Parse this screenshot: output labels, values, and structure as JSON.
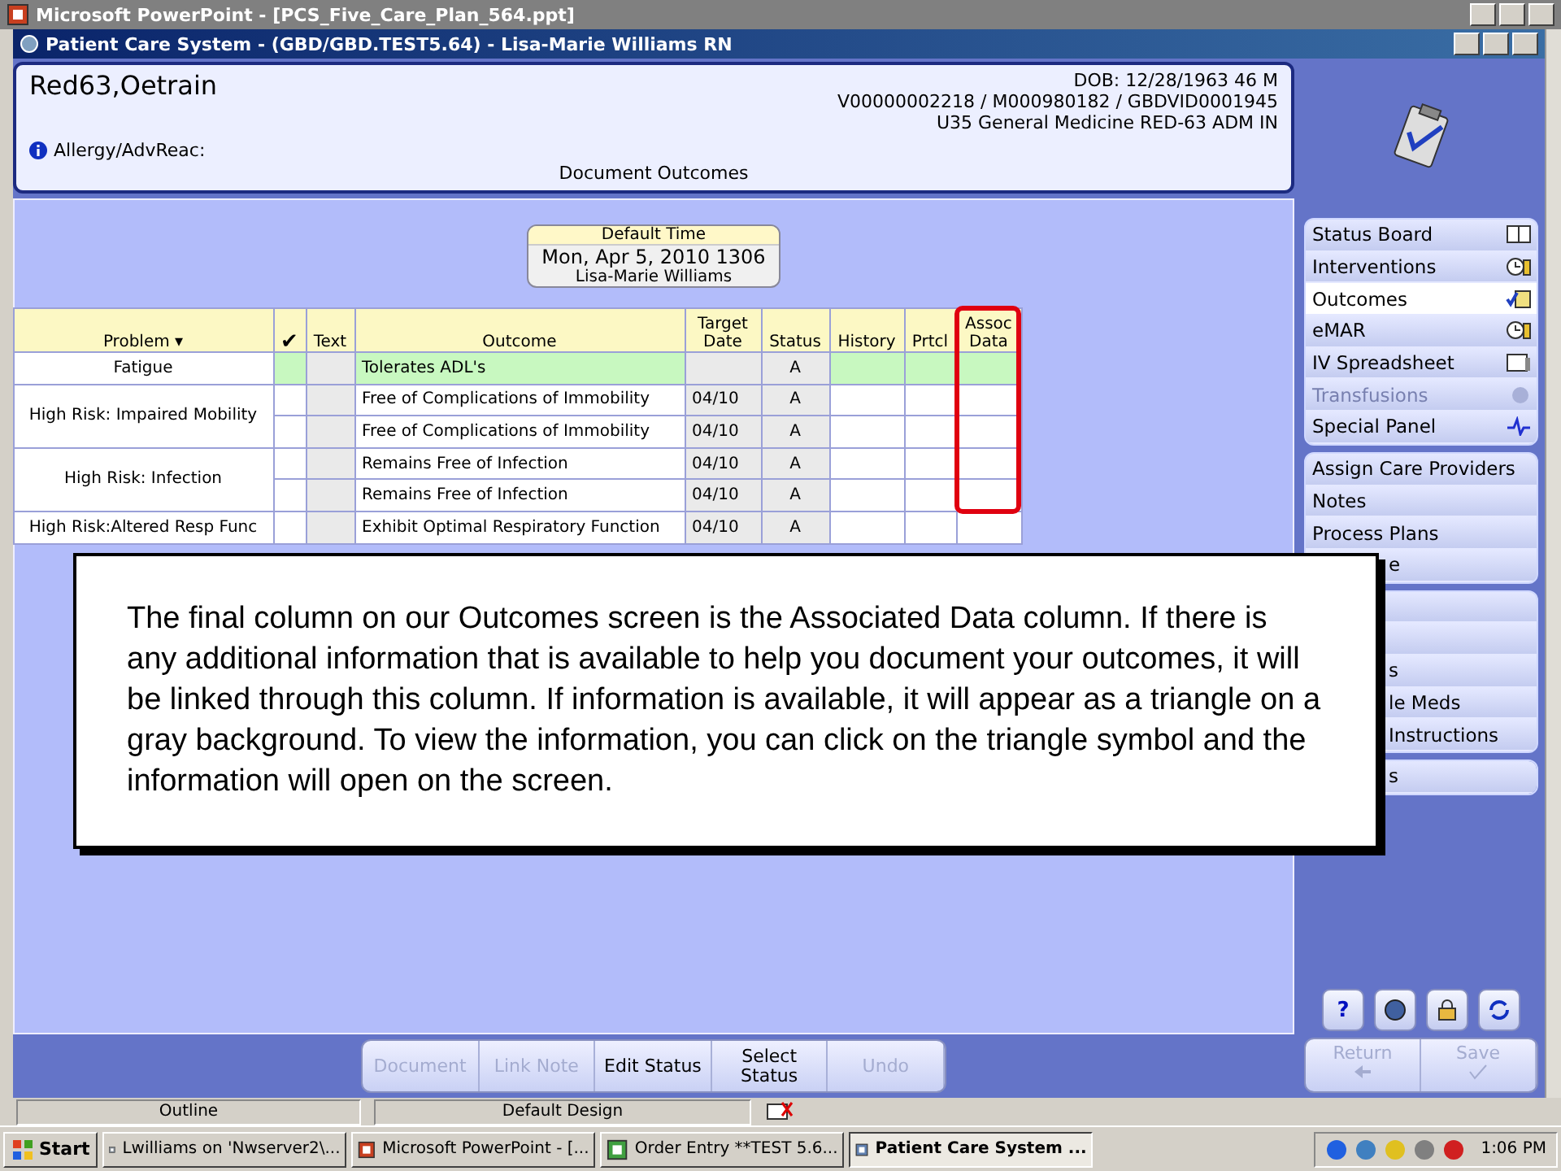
{
  "ppt_window": {
    "title": "Microsoft PowerPoint - [PCS_Five_Care_Plan_564.ppt]"
  },
  "app_window": {
    "title": "Patient Care System - (GBD/GBD.TEST5.64) - Lisa-Marie Williams RN"
  },
  "patient": {
    "name": "Red63,Oetrain",
    "dob": "DOB: 12/28/1963 46 M",
    "ids": "V00000002218 / M000980182 / GBDVID0001945",
    "location": "U35 General Medicine  RED-63  ADM IN",
    "allergy": "Allergy/AdvReac:",
    "screen_title": "Document Outcomes"
  },
  "default_time": {
    "label": "Default Time",
    "date": "Mon, Apr 5, 2010  1306",
    "user": "Lisa-Marie Williams"
  },
  "table": {
    "columns": [
      "Problem ▾",
      "✔",
      "Text",
      "Outcome",
      "Target Date",
      "Status",
      "History",
      "Prtcl",
      "Assoc Data"
    ],
    "groups": [
      {
        "problem": "Fatigue",
        "selected": true,
        "outcomes": [
          {
            "outcome": "Tolerates ADL's",
            "status": "A"
          }
        ]
      },
      {
        "problem": "High Risk: Impaired Mobility",
        "selected": false,
        "outcomes": [
          {
            "outcome": "Free of Complications of Immobility",
            "target": "04/10",
            "status": "A"
          },
          {
            "outcome": "Free of Complications of Immobility",
            "target": "04/10",
            "status": "A"
          }
        ]
      },
      {
        "problem": "High Risk: Infection",
        "selected": false,
        "outcomes": [
          {
            "outcome": "Remains Free of Infection",
            "target": "04/10",
            "status": "A"
          },
          {
            "outcome": "Remains Free of Infection",
            "target": "04/10",
            "status": "A"
          }
        ]
      },
      {
        "problem": "High Risk:Altered Resp Func",
        "selected": false,
        "outcomes": [
          {
            "outcome": "Exhibit Optimal Respiratory Function",
            "target": "04/10",
            "status": "A"
          }
        ]
      }
    ]
  },
  "callout": {
    "text": "The final column on our Outcomes screen is the Associated Data column. If there is any additional information that is available to help you document your outcomes, it will be linked through this column. If information is available, it will appear as a triangle on a gray background. To view the information, you can click on the triangle symbol and the information will open on the screen."
  },
  "sidebar": [
    [
      {
        "label": "Status Board",
        "selected": false,
        "disabled": false
      },
      {
        "label": "Interventions",
        "selected": false,
        "disabled": false
      },
      {
        "label": "Outcomes",
        "selected": true,
        "disabled": false
      },
      {
        "label": "eMAR",
        "selected": false,
        "disabled": false
      },
      {
        "label": "IV Spreadsheet",
        "selected": false,
        "disabled": false
      },
      {
        "label": "Transfusions",
        "selected": false,
        "disabled": true
      },
      {
        "label": "Special Panel",
        "selected": false,
        "disabled": false
      }
    ],
    [
      {
        "label": "Assign Care Providers",
        "selected": false,
        "disabled": false
      },
      {
        "label": "Notes",
        "selected": false,
        "disabled": false
      },
      {
        "label": "Process Plans",
        "selected": false,
        "disabled": false
      },
      {
        "label": "e",
        "kind": "partial"
      }
    ],
    [
      {
        "kind": "covered"
      },
      {
        "kind": "covered"
      },
      {
        "label": "s",
        "kind": "partial"
      },
      {
        "label": "le Meds",
        "kind": "partial"
      },
      {
        "label": "Instructions",
        "kind": "partial"
      }
    ],
    [
      {
        "label": "s",
        "kind": "partial"
      }
    ]
  ],
  "help_label": "?",
  "toolbar": [
    {
      "label": "Document",
      "disabled": true
    },
    {
      "label": "Link Note",
      "disabled": true
    },
    {
      "label": "Edit Status",
      "disabled": false
    },
    {
      "label": "Select Status",
      "disabled": false
    },
    {
      "label": "Undo",
      "disabled": true
    }
  ],
  "nav_buttons": [
    {
      "label": "Return",
      "disabled": true
    },
    {
      "label": "Save",
      "disabled": true
    }
  ],
  "ppt_status": [
    "Outline",
    "Default Design"
  ],
  "taskbar": {
    "start": "Start",
    "tasks": [
      {
        "label": "Lwilliams on 'Nwserver2\\...",
        "selected": false
      },
      {
        "label": "Microsoft PowerPoint - [...",
        "selected": false
      },
      {
        "label": "Order Entry **TEST 5.6...",
        "selected": false
      },
      {
        "label": "Patient Care System ...",
        "selected": true
      }
    ],
    "clock": "1:06 PM"
  }
}
